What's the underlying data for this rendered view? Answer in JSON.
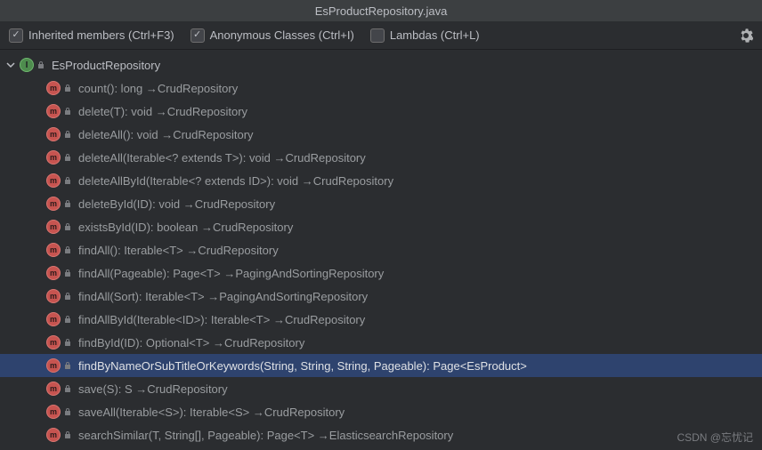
{
  "title": "EsProductRepository.java",
  "toolbar": {
    "inherited": {
      "label": "Inherited members (Ctrl+F3)",
      "checked": true
    },
    "anonymous": {
      "label": "Anonymous Classes (Ctrl+I)",
      "checked": true
    },
    "lambdas": {
      "label": "Lambdas (Ctrl+L)",
      "checked": false
    }
  },
  "tree": {
    "root": {
      "label": "EsProductRepository"
    },
    "items": [
      {
        "label": "count(): long →CrudRepository",
        "selected": false
      },
      {
        "label": "delete(T): void →CrudRepository",
        "selected": false
      },
      {
        "label": "deleteAll(): void →CrudRepository",
        "selected": false
      },
      {
        "label": "deleteAll(Iterable<? extends T>): void →CrudRepository",
        "selected": false
      },
      {
        "label": "deleteAllById(Iterable<? extends ID>): void →CrudRepository",
        "selected": false
      },
      {
        "label": "deleteById(ID): void →CrudRepository",
        "selected": false
      },
      {
        "label": "existsById(ID): boolean →CrudRepository",
        "selected": false
      },
      {
        "label": "findAll(): Iterable<T> →CrudRepository",
        "selected": false
      },
      {
        "label": "findAll(Pageable): Page<T> →PagingAndSortingRepository",
        "selected": false
      },
      {
        "label": "findAll(Sort): Iterable<T> →PagingAndSortingRepository",
        "selected": false
      },
      {
        "label": "findAllById(Iterable<ID>): Iterable<T> →CrudRepository",
        "selected": false
      },
      {
        "label": "findById(ID): Optional<T> →CrudRepository",
        "selected": false
      },
      {
        "label": "findByNameOrSubTitleOrKeywords(String, String, String, Pageable): Page<EsProduct>",
        "selected": true
      },
      {
        "label": "save(S): S →CrudRepository",
        "selected": false
      },
      {
        "label": "saveAll(Iterable<S>): Iterable<S> →CrudRepository",
        "selected": false
      },
      {
        "label": "searchSimilar(T, String[], Pageable): Page<T> →ElasticsearchRepository",
        "selected": false
      }
    ]
  },
  "watermark": "CSDN @忘忧记"
}
